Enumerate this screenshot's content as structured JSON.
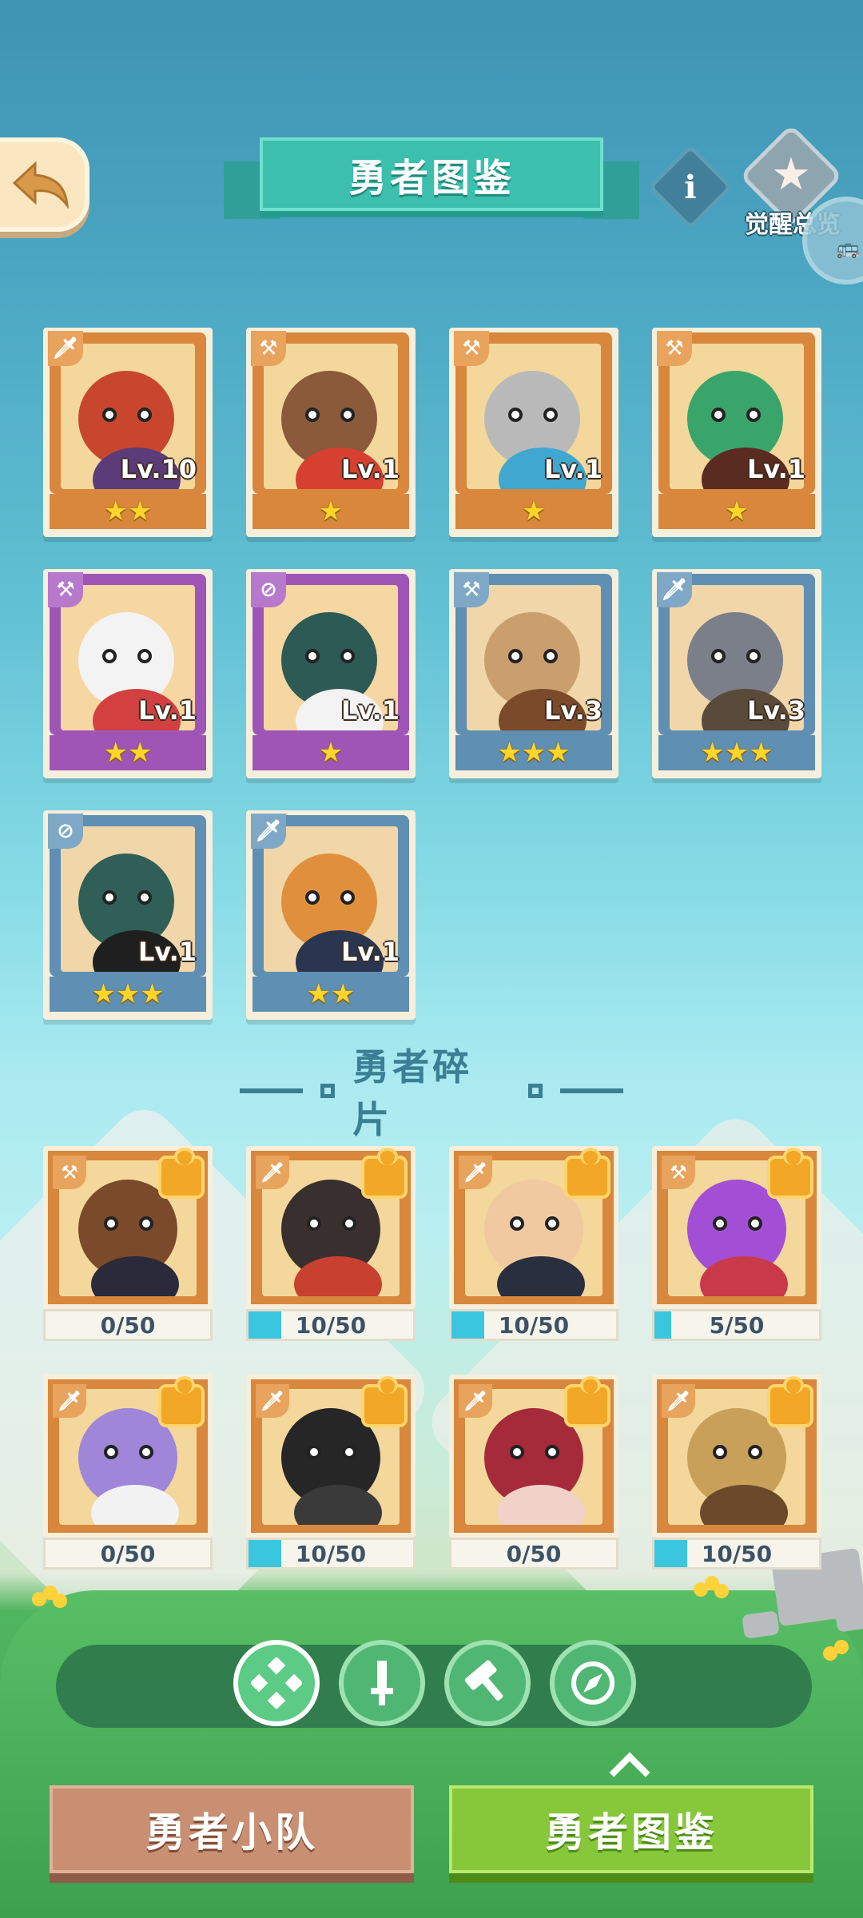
{
  "header": {
    "title": "勇者图鉴",
    "info_label": "i",
    "awaken_label": "觉醒总览",
    "side_icon": "bus-icon"
  },
  "heroes": [
    {
      "level": "Lv.10",
      "stars": "★★",
      "color": "orange",
      "class_icon": "sword-icon"
    },
    {
      "level": "Lv.1",
      "stars": "★",
      "color": "orange",
      "class_icon": "hammer-icon"
    },
    {
      "level": "Lv.1",
      "stars": "★",
      "color": "orange",
      "class_icon": "hammer-icon"
    },
    {
      "level": "Lv.1",
      "stars": "★",
      "color": "orange",
      "class_icon": "hammer-icon"
    },
    {
      "level": "Lv.1",
      "stars": "★★",
      "color": "purple",
      "class_icon": "hammer-icon"
    },
    {
      "level": "Lv.1",
      "stars": "★",
      "color": "purple",
      "class_icon": "compass-icon"
    },
    {
      "level": "Lv.3",
      "stars": "★★★",
      "color": "blue",
      "class_icon": "hammer-icon"
    },
    {
      "level": "Lv.3",
      "stars": "★★★",
      "color": "blue",
      "class_icon": "sword-icon"
    },
    {
      "level": "Lv.1",
      "stars": "★★★",
      "color": "blue",
      "class_icon": "compass-icon"
    },
    {
      "level": "Lv.1",
      "stars": "★★",
      "color": "blue",
      "class_icon": "sword-icon"
    }
  ],
  "fragments_section": {
    "title": "勇者碎片"
  },
  "fragments": [
    {
      "count": "0/50",
      "progress": 0,
      "class_icon": "hammer-icon"
    },
    {
      "count": "10/50",
      "progress": 0.2,
      "class_icon": "sword-icon"
    },
    {
      "count": "10/50",
      "progress": 0.2,
      "class_icon": "sword-icon"
    },
    {
      "count": "5/50",
      "progress": 0.1,
      "class_icon": "hammer-icon"
    },
    {
      "count": "0/50",
      "progress": 0,
      "class_icon": "sword-icon"
    },
    {
      "count": "10/50",
      "progress": 0.2,
      "class_icon": "sword-icon"
    },
    {
      "count": "0/50",
      "progress": 0,
      "class_icon": "sword-icon"
    },
    {
      "count": "10/50",
      "progress": 0.2,
      "class_icon": "sword-icon"
    }
  ],
  "filters": [
    {
      "name": "all-filter-icon",
      "active": true
    },
    {
      "name": "sword-filter-icon",
      "active": false
    },
    {
      "name": "hammer-filter-icon",
      "active": false
    },
    {
      "name": "compass-filter-icon",
      "active": false
    }
  ],
  "tabs": {
    "team": "勇者小队",
    "album": "勇者图鉴"
  },
  "colors": {
    "orange": "#d8873c",
    "purple": "#9e55b6",
    "blue": "#5f8fb2",
    "progress": "#3ac6de",
    "tab_active": "#87c73a",
    "tab_inactive": "#c98f73"
  }
}
